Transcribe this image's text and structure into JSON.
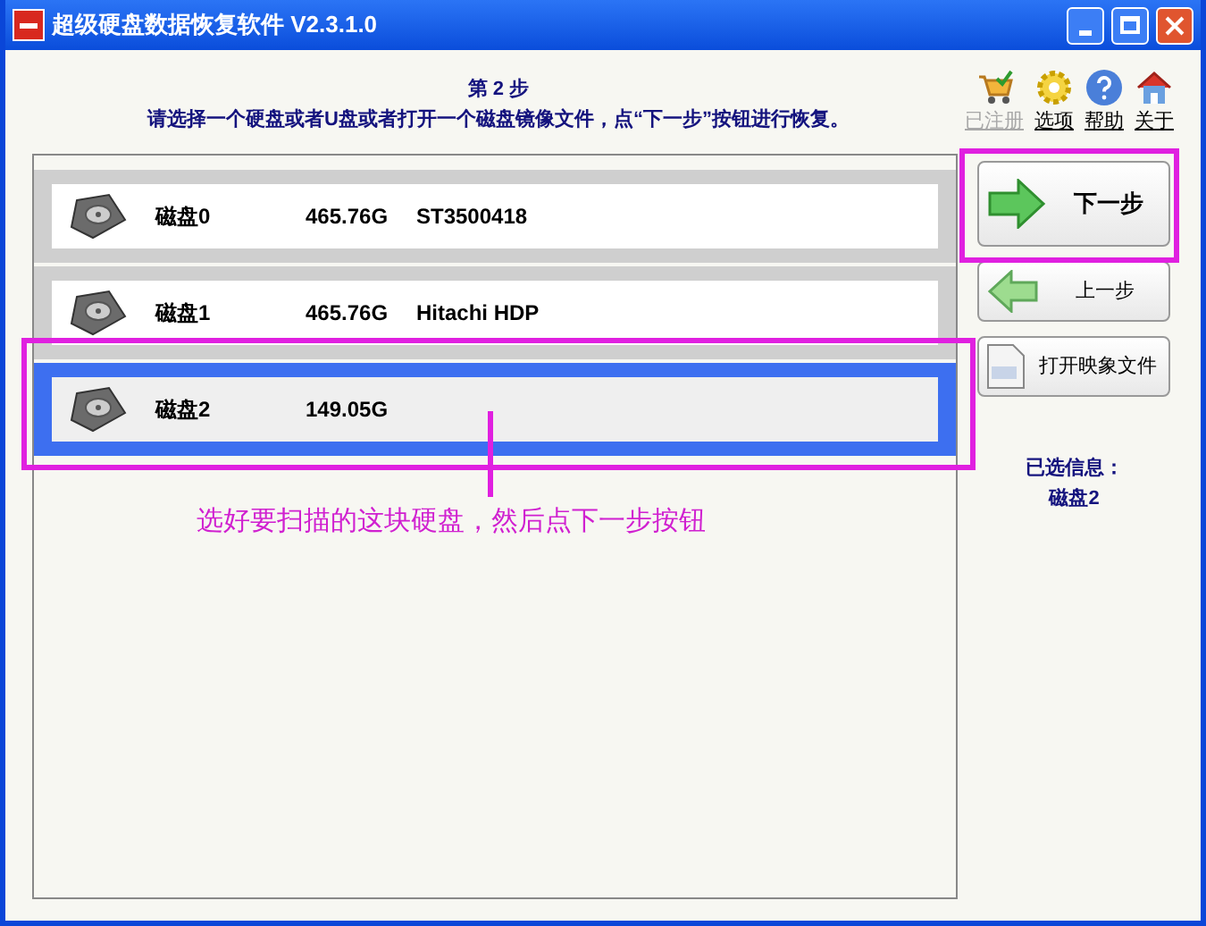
{
  "window": {
    "title": "超级硬盘数据恢复软件 V2.3.1.0"
  },
  "header": {
    "step": "第 2 步",
    "instruction": "请选择一个硬盘或者U盘或者打开一个磁盘镜像文件，点“下一步”按钮进行恢复。"
  },
  "toolbar": [
    {
      "kind": "cart",
      "label": "已注册",
      "disabled": true
    },
    {
      "kind": "gear",
      "label": "选项",
      "disabled": false
    },
    {
      "kind": "help",
      "label": "帮助",
      "disabled": false
    },
    {
      "kind": "home",
      "label": "关于",
      "disabled": false
    }
  ],
  "disks": [
    {
      "name": "磁盘0",
      "size": "465.76G",
      "model": "ST3500418",
      "selected": false
    },
    {
      "name": "磁盘1",
      "size": "465.76G",
      "model": "Hitachi HDP",
      "selected": false
    },
    {
      "name": "磁盘2",
      "size": "149.05G",
      "selected": true
    }
  ],
  "buttons": [
    {
      "kind": "next",
      "label": "下一步"
    },
    {
      "kind": "back",
      "label": "上一步"
    },
    {
      "kind": "image",
      "label": "打开映象文件"
    }
  ],
  "selected_info": {
    "label": "已选信息：",
    "value": "磁盘2"
  },
  "annotation": "选好要扫描的这块硬盘，然后点下一步按钮"
}
